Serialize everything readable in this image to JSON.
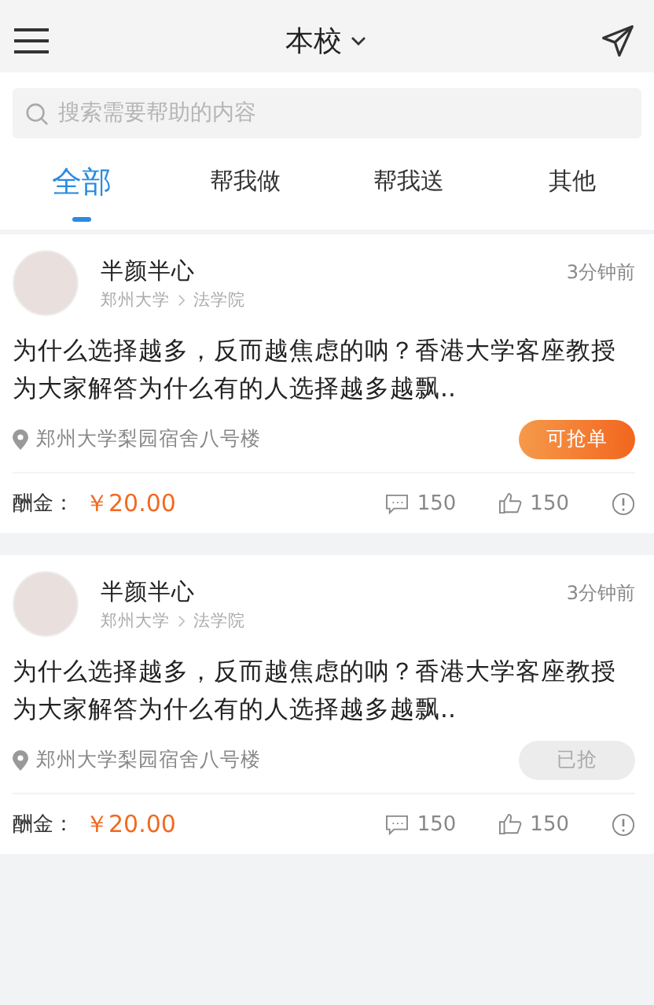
{
  "header": {
    "title": "本校"
  },
  "search": {
    "placeholder": "搜索需要帮助的内容"
  },
  "tabs": [
    {
      "label": "全部",
      "selected": true
    },
    {
      "label": "帮我做",
      "selected": false
    },
    {
      "label": "帮我送",
      "selected": false
    },
    {
      "label": "其他",
      "selected": false
    }
  ],
  "posts": [
    {
      "user": "半颜半心",
      "school": "郑州大学",
      "college": "法学院",
      "time": "3分钟前",
      "content": "为什么选择越多，反而越焦虑的呐？香港大学客座教授为大家解答为什么有的人选择越多越飘..",
      "location": "郑州大学梨园宿舍八号楼",
      "action": "可抢单",
      "available": true,
      "reward_label": "酬金：",
      "reward": "￥20.00",
      "comments": "150",
      "likes": "150"
    },
    {
      "user": "半颜半心",
      "school": "郑州大学",
      "college": "法学院",
      "time": "3分钟前",
      "content": "为什么选择越多，反而越焦虑的呐？香港大学客座教授为大家解答为什么有的人选择越多越飘..",
      "location": "郑州大学梨园宿舍八号楼",
      "action": "已抢",
      "available": false,
      "reward_label": "酬金：",
      "reward": "￥20.00",
      "comments": "150",
      "likes": "150"
    }
  ]
}
